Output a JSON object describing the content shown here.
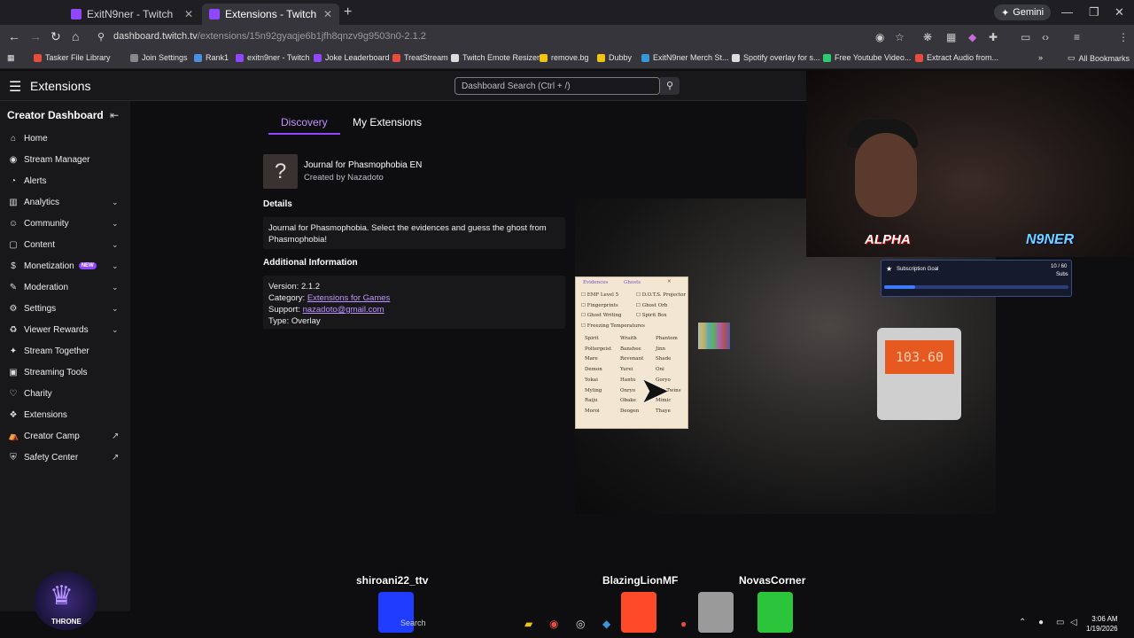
{
  "browser": {
    "tabs": [
      {
        "label": "ExitN9ner - Twitch",
        "active": false
      },
      {
        "label": "Extensions - Twitch",
        "active": true
      }
    ],
    "new_tab": "+",
    "gemini": "Gemini",
    "url_host": "dashboard.twitch.tv",
    "url_path": "/extensions/15n92gyaqje6b1jfh8qnzv9g9503n0-2.1.2",
    "bookmarks": [
      {
        "label": "Tasker File Library",
        "color": "#e74c3c"
      },
      {
        "label": "Join Settings",
        "color": "#888888"
      },
      {
        "label": "Rank1",
        "color": "#4a90e2"
      },
      {
        "label": "exitn9ner - Twitch",
        "color": "#9146ff"
      },
      {
        "label": "Joke Leaderboard",
        "color": "#9146ff"
      },
      {
        "label": "TreatStream",
        "color": "#e74c3c"
      },
      {
        "label": "Twitch Emote Resizer",
        "color": "#dddddd"
      },
      {
        "label": "remove.bg",
        "color": "#f1c40f"
      },
      {
        "label": "Dubby",
        "color": "#f1c40f"
      },
      {
        "label": "ExitN9ner Merch St...",
        "color": "#3498db"
      },
      {
        "label": "Spotify overlay for s...",
        "color": "#dddddd"
      },
      {
        "label": "Free Youtube Video...",
        "color": "#2ecc71"
      },
      {
        "label": "Extract Audio from...",
        "color": "#e74c3c"
      }
    ],
    "all_bookmarks": "All Bookmarks"
  },
  "twitch": {
    "section_title": "Extensions",
    "search_placeholder": "Dashboard Search (Ctrl + /)"
  },
  "sidebar": {
    "title": "Creator Dashboard",
    "items": [
      {
        "label": "Home",
        "icon": "⌂",
        "chevron": false
      },
      {
        "label": "Stream Manager",
        "icon": "◉",
        "chevron": false
      },
      {
        "label": "Alerts",
        "icon": "◔",
        "chevron": false
      },
      {
        "label": "Analytics",
        "icon": "▥",
        "chevron": true
      },
      {
        "label": "Community",
        "icon": "☺",
        "chevron": true
      },
      {
        "label": "Content",
        "icon": "▢",
        "chevron": true
      },
      {
        "label": "Monetization",
        "icon": "$",
        "chevron": true,
        "badge": "NEW"
      },
      {
        "label": "Moderation",
        "icon": "✎",
        "chevron": true
      },
      {
        "label": "Settings",
        "icon": "⚙",
        "chevron": true
      },
      {
        "label": "Viewer Rewards",
        "icon": "♻",
        "chevron": true
      },
      {
        "label": "Stream Together",
        "icon": "✦",
        "chevron": false
      },
      {
        "label": "Streaming Tools",
        "icon": "▣",
        "chevron": false
      },
      {
        "label": "Charity",
        "icon": "♡",
        "chevron": false
      },
      {
        "label": "Extensions",
        "icon": "❖",
        "chevron": false
      },
      {
        "label": "Creator Camp",
        "icon": "⛺",
        "external": true
      },
      {
        "label": "Safety Center",
        "icon": "⛨",
        "external": true
      }
    ]
  },
  "main": {
    "tabs": [
      "Discovery",
      "My Extensions"
    ],
    "extension": {
      "name": "Journal for Phasmophobia EN",
      "author": "Created by Nazadoto"
    },
    "details_heading": "Details",
    "details_text": "Journal for Phasmophobia. Select the evidences and guess the ghost from Phasmophobia!",
    "additional_heading": "Additional Information",
    "version": "Version: 2.1.2",
    "category_label": "Category: ",
    "category_value": "Extensions for Games",
    "support_label": "Support: ",
    "support_value": "nazadoto@gmail.com",
    "type": "Type: Overlay"
  },
  "overlay": {
    "journal_tabs": [
      "Evidences",
      "Ghosts"
    ],
    "evidences": [
      "EMF Level 5",
      "D.O.T.S. Projector",
      "Fingerprints",
      "Ghost Orb",
      "Ghost Writing",
      "Spirit Box",
      "Freezing Temperatures"
    ],
    "ghosts": [
      "Spirit",
      "Wraith",
      "Phantom",
      "Poltergeist",
      "Banshee",
      "Jinn",
      "Mare",
      "Revenant",
      "Shade",
      "Demon",
      "Yurei",
      "Oni",
      "Yokai",
      "Hantu",
      "Goryo",
      "Myling",
      "Onryo",
      "The Twins",
      "Raiju",
      "Obake",
      "Mimic",
      "Moroi",
      "Deogen",
      "Thaye"
    ],
    "device_reading": "103.60",
    "alpha": "ALPHA",
    "n9ner": "N9NER",
    "subgoal_label": "Subscription Goal",
    "subgoal_count": "10 / 60",
    "subgoal_unit": "Subs",
    "subgoal_progress": 0.17
  },
  "chatters": [
    "shiroani22_ttv",
    "BlazingLionMF",
    "NovasCorner"
  ],
  "throne": "THRONE",
  "taskbar": {
    "search": "Search",
    "time": "3:06 AM",
    "date": "1/19/2026"
  }
}
